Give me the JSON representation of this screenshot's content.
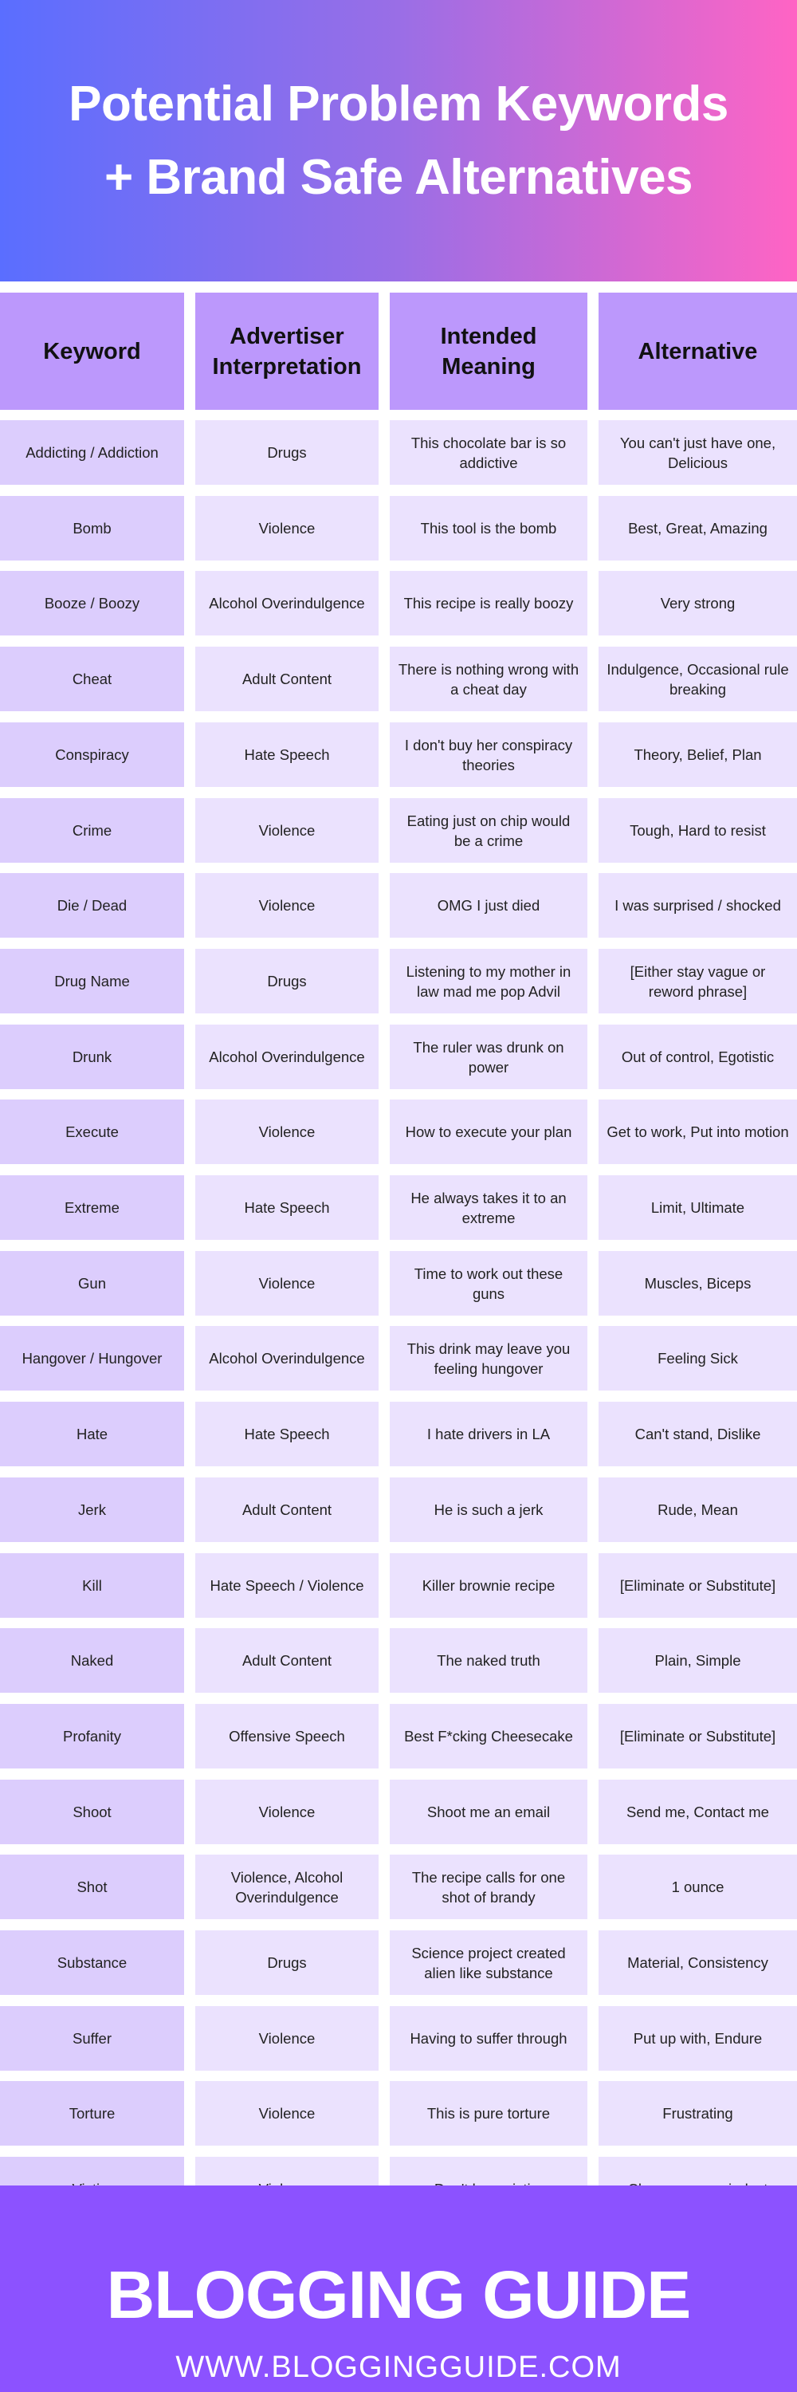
{
  "hero": {
    "title_line1": "Potential Problem Keywords",
    "title_line2": "+ Brand Safe Alternatives"
  },
  "colors": {
    "gradient_start": "#5a6eff",
    "gradient_end": "#ff64c4",
    "header_cell": "#bc98fc",
    "keyword_cell": "#dccdfd",
    "body_cell": "#ebe2fe",
    "footer_bg": "#8c52ff"
  },
  "table": {
    "headers": [
      "Keyword",
      "Advertiser Interpretation",
      "Intended Meaning",
      "Alternative"
    ],
    "rows": [
      {
        "keyword": "Addicting / Addiction",
        "interpretation": "Drugs",
        "meaning": "This chocolate bar is so addictive",
        "alternative": "You can't just have one, Delicious"
      },
      {
        "keyword": "Bomb",
        "interpretation": "Violence",
        "meaning": "This tool is the bomb",
        "alternative": "Best, Great, Amazing"
      },
      {
        "keyword": "Booze / Boozy",
        "interpretation": "Alcohol Overindulgence",
        "meaning": "This recipe is really boozy",
        "alternative": "Very strong"
      },
      {
        "keyword": "Cheat",
        "interpretation": "Adult Content",
        "meaning": "There is nothing wrong with a cheat day",
        "alternative": "Indulgence, Occasional rule breaking"
      },
      {
        "keyword": "Conspiracy",
        "interpretation": "Hate Speech",
        "meaning": "I don't buy her conspiracy theories",
        "alternative": "Theory, Belief, Plan"
      },
      {
        "keyword": "Crime",
        "interpretation": "Violence",
        "meaning": "Eating just on chip would be a crime",
        "alternative": "Tough, Hard to resist"
      },
      {
        "keyword": "Die / Dead",
        "interpretation": "Violence",
        "meaning": "OMG I just died",
        "alternative": "I was surprised / shocked"
      },
      {
        "keyword": "Drug Name",
        "interpretation": "Drugs",
        "meaning": "Listening to my mother in law mad me pop Advil",
        "alternative": "[Either stay vague or reword phrase]"
      },
      {
        "keyword": "Drunk",
        "interpretation": "Alcohol Overindulgence",
        "meaning": "The ruler was drunk on power",
        "alternative": "Out of control, Egotistic"
      },
      {
        "keyword": "Execute",
        "interpretation": "Violence",
        "meaning": "How to execute your plan",
        "alternative": "Get to work, Put into motion"
      },
      {
        "keyword": "Extreme",
        "interpretation": "Hate Speech",
        "meaning": "He always takes it to an extreme",
        "alternative": "Limit, Ultimate"
      },
      {
        "keyword": "Gun",
        "interpretation": "Violence",
        "meaning": "Time to work out these guns",
        "alternative": "Muscles, Biceps"
      },
      {
        "keyword": "Hangover / Hungover",
        "interpretation": "Alcohol Overindulgence",
        "meaning": "This drink may leave you feeling hungover",
        "alternative": "Feeling Sick"
      },
      {
        "keyword": "Hate",
        "interpretation": "Hate Speech",
        "meaning": "I hate drivers in LA",
        "alternative": "Can't stand, Dislike"
      },
      {
        "keyword": "Jerk",
        "interpretation": "Adult Content",
        "meaning": "He is such a jerk",
        "alternative": "Rude, Mean"
      },
      {
        "keyword": "Kill",
        "interpretation": "Hate Speech / Violence",
        "meaning": "Killer brownie recipe",
        "alternative": "[Eliminate or Substitute]"
      },
      {
        "keyword": "Naked",
        "interpretation": "Adult Content",
        "meaning": "The naked truth",
        "alternative": "Plain, Simple"
      },
      {
        "keyword": "Profanity",
        "interpretation": "Offensive Speech",
        "meaning": "Best F*cking Cheesecake",
        "alternative": "[Eliminate or Substitute]"
      },
      {
        "keyword": "Shoot",
        "interpretation": "Violence",
        "meaning": "Shoot me an email",
        "alternative": "Send me, Contact me"
      },
      {
        "keyword": "Shot",
        "interpretation": "Violence, Alcohol Overindulgence",
        "meaning": "The recipe calls for one shot of brandy",
        "alternative": "1 ounce"
      },
      {
        "keyword": "Substance",
        "interpretation": "Drugs",
        "meaning": "Science project created alien like substance",
        "alternative": "Material, Consistency"
      },
      {
        "keyword": "Suffer",
        "interpretation": "Violence",
        "meaning": "Having to suffer through",
        "alternative": "Put up with, Endure"
      },
      {
        "keyword": "Torture",
        "interpretation": "Violence",
        "meaning": "This is pure torture",
        "alternative": "Frustrating"
      },
      {
        "keyword": "Victim",
        "interpretation": "Violence",
        "meaning": "Don't be a victim",
        "alternative": "Change your mindset"
      }
    ]
  },
  "footer": {
    "brand": "BLOGGING GUIDE",
    "url": "WWW.BLOGGINGGUIDE.COM"
  }
}
